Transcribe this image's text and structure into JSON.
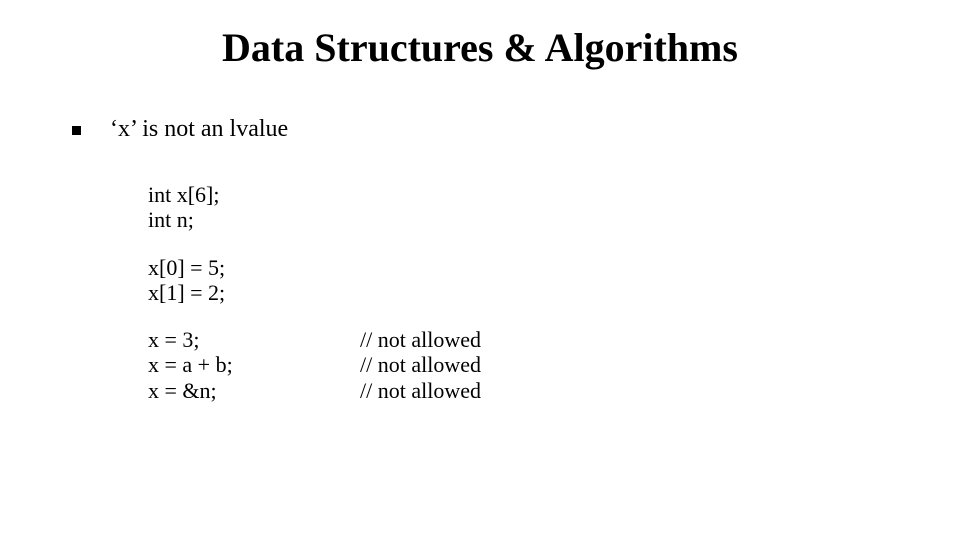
{
  "slide": {
    "title": "Data Structures & Algorithms",
    "bullet": "‘x’ is not an lvalue",
    "code": {
      "group1": {
        "line1": "int x[6];",
        "line2": "int n;"
      },
      "group2": {
        "line1": "x[0] = 5;",
        "line2": "x[1] = 2;"
      },
      "group3": {
        "line1_left": "x = 3;",
        "line1_right": "// not allowed",
        "line2_left": "x = a + b;",
        "line2_right": "// not allowed",
        "line3_left": "x = &n;",
        "line3_right": "// not allowed"
      }
    }
  }
}
